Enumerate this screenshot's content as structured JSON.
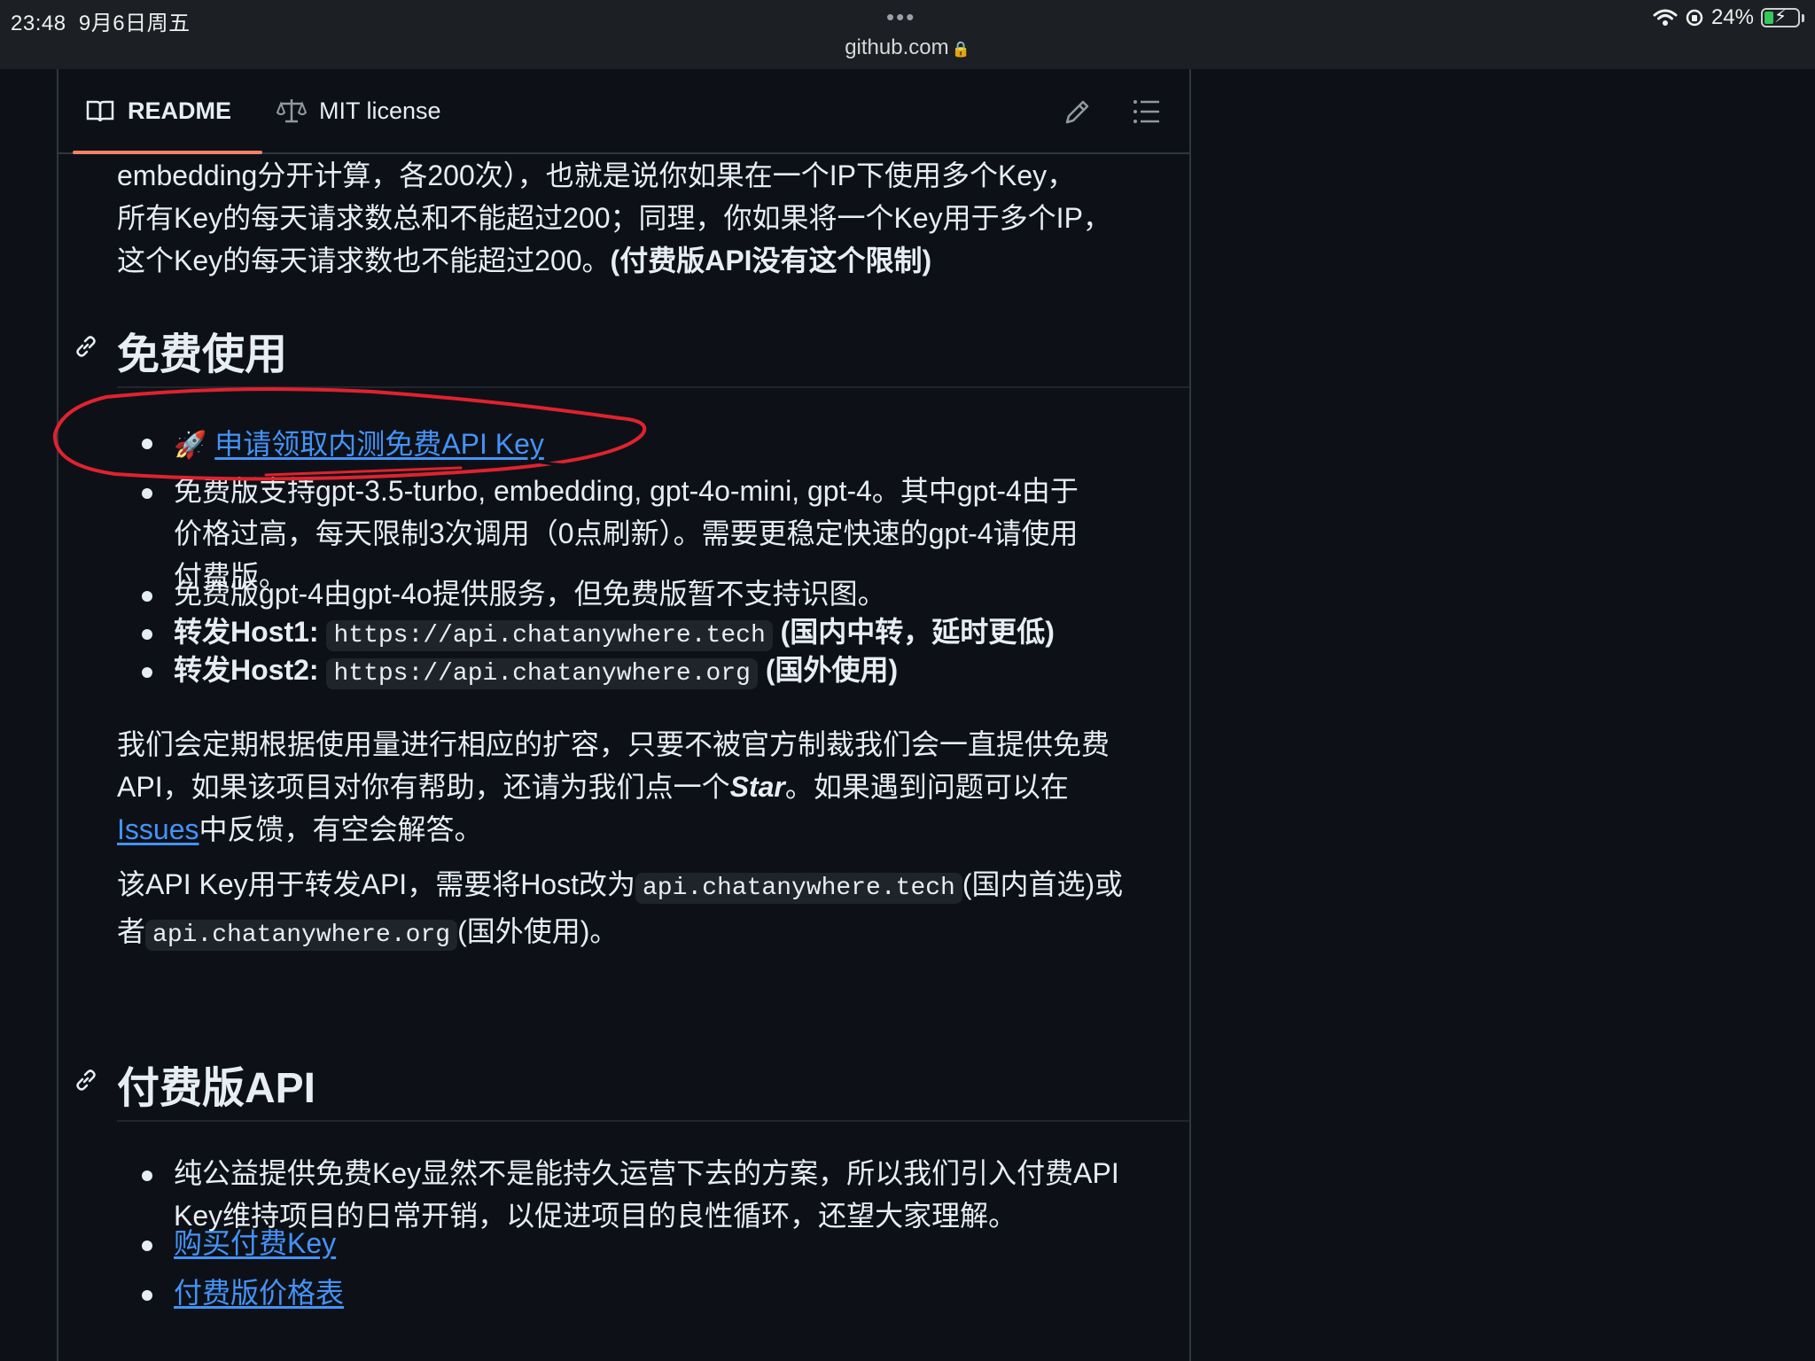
{
  "status": {
    "time": "23:48",
    "date": "9月6日周五",
    "battery": "24%",
    "url": "github.com"
  },
  "tabs": {
    "readme": "README",
    "license": "MIT license"
  },
  "content": {
    "intro_lines": [
      "embedding分开计算，各200次），也就是说你如果在一个IP下使用多个Key，",
      "所有Key的每天请求数总和不能超过200；同理，你如果将一个Key用于多个IP，"
    ],
    "intro_line3": "这个Key的每天请求数也不能超过200。",
    "intro_line3_bold": "(付费版API没有这个限制)",
    "h_free": "免费使用",
    "free_list": {
      "apply_link": "申请领取内测免费API Key",
      "support_lines": [
        "免费版支持gpt-3.5-turbo, embedding, gpt-4o-mini, gpt-4。其中gpt-4由于",
        "价格过高，每天限制3次调用（0点刷新）。需要更稳定快速的gpt-4请使用",
        "付费版。"
      ],
      "gpt4_note": "免费版gpt-4由gpt-4o提供服务，但免费版暂不支持识图。",
      "host1_label": "转发Host1:",
      "host1_url": "https://api.chatanywhere.tech",
      "host1_note": "(国内中转，延时更低)",
      "host2_label": "转发Host2:",
      "host2_url": "https://api.chatanywhere.org",
      "host2_note": "(国外使用)"
    },
    "expand_line1": "我们会定期根据使用量进行相应的扩容，只要不被官方制裁我们会一直提供免费",
    "expand_line2_a": "API，如果该项目对你有帮助，还请为我们点一个",
    "expand_line2_star": "Star",
    "expand_line2_b": "。如果遇到问题可以在",
    "issues_link": "Issues",
    "expand_line3_rest": "中反馈，有空会解答。",
    "host_line1_a": "该API Key用于转发API，需要将Host改为",
    "host_code1": "api.chatanywhere.tech",
    "host_line1_b": "(国内首选)或",
    "host_line2_a": "者",
    "host_code2": "api.chatanywhere.org",
    "host_line2_b": "(国外使用)。",
    "h_paid": "付费版API",
    "paid_lines": [
      "纯公益提供免费Key显然不是能持久运营下去的方案，所以我们引入付费API",
      "Key维持项目的日常开销，以促进项目的良性循环，还望大家理解。"
    ],
    "buy_link": "购买付费Key",
    "price_link": "付费版价格表"
  },
  "colors": {
    "background": "#0d1117",
    "link": "#4493f8",
    "tab_underline": "#f78166",
    "annotation": "#e0222f"
  }
}
